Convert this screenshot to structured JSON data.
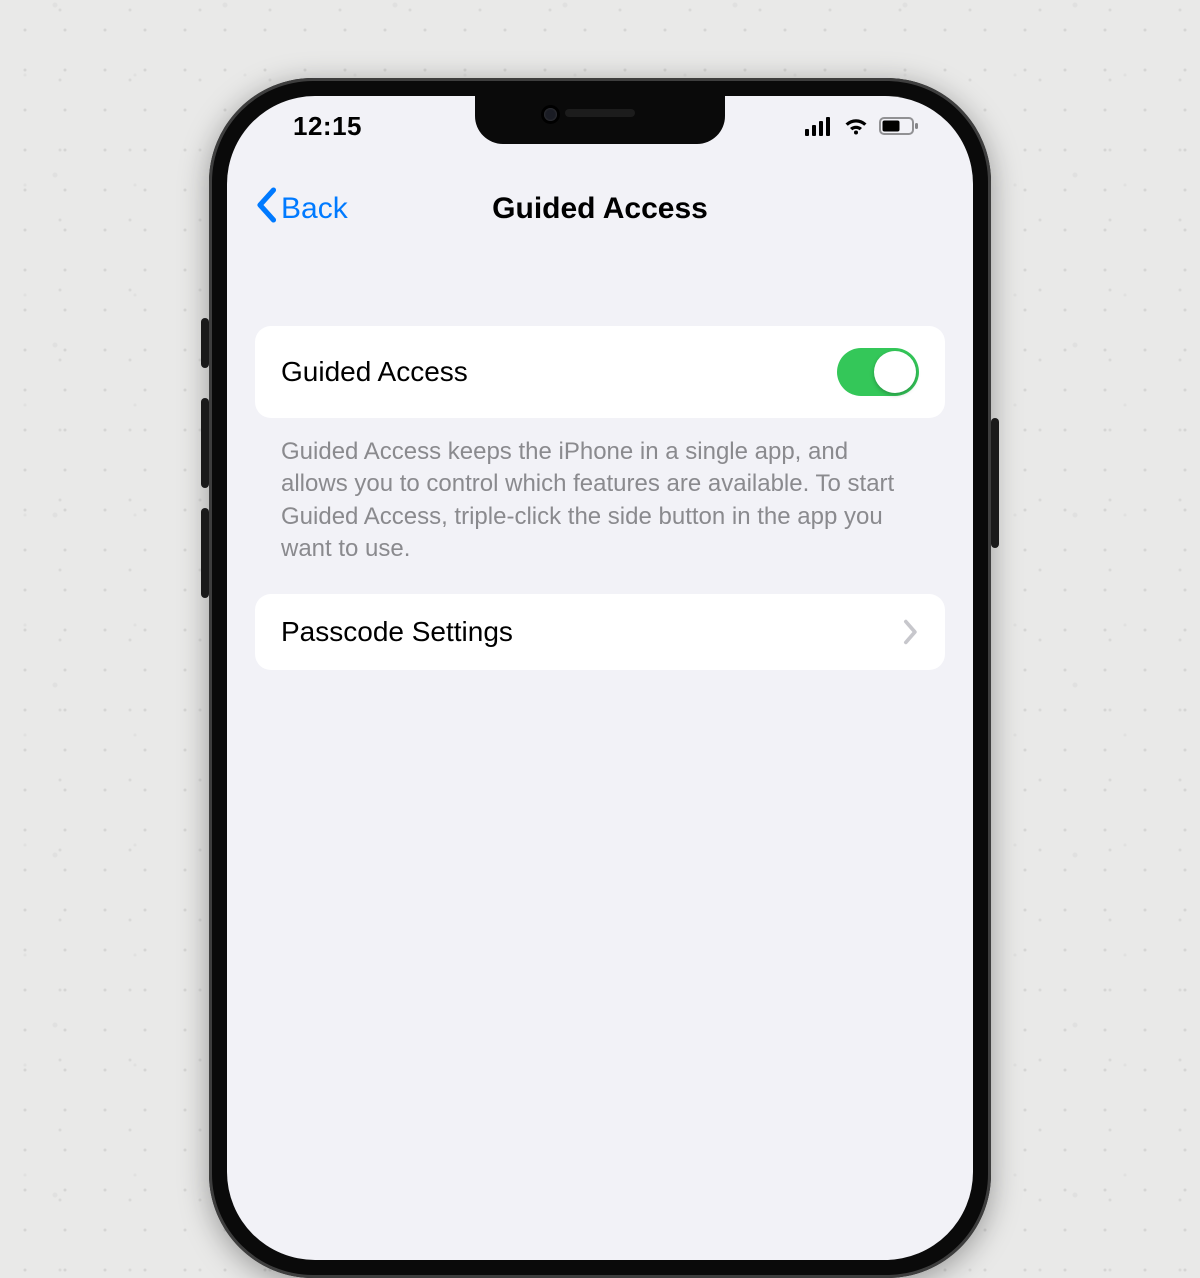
{
  "status": {
    "time": "12:15",
    "icons": {
      "cellular": "cellular-icon",
      "wifi": "wifi-icon",
      "battery": "battery-icon"
    },
    "battery_level_percent": 55
  },
  "nav": {
    "back_label": "Back",
    "title": "Guided Access"
  },
  "toggle_row": {
    "label": "Guided Access",
    "value_on": true
  },
  "description": "Guided Access keeps the iPhone in a single app, and allows you to control which features are available. To start Guided Access, triple-click the side button in the app you want to use.",
  "passcode_row": {
    "label": "Passcode Settings"
  },
  "colors": {
    "link": "#007aff",
    "toggle_on": "#34c759",
    "bg": "#f2f2f7"
  }
}
